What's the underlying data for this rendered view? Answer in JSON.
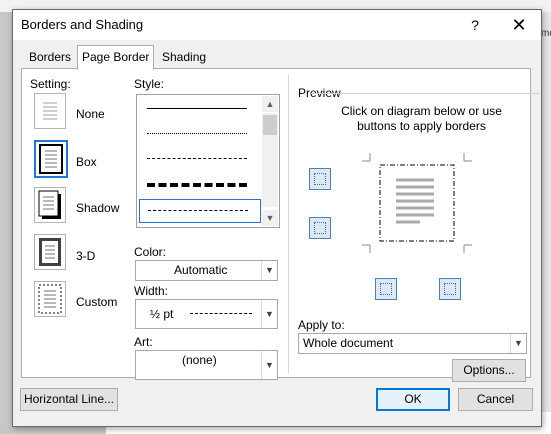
{
  "background": {
    "side_text": "mo"
  },
  "window": {
    "title": "Borders and Shading",
    "help_glyph": "?",
    "close_glyph": "✕"
  },
  "tabs": [
    {
      "label": "Borders",
      "active": false
    },
    {
      "label": "Page Border",
      "active": true
    },
    {
      "label": "Shading",
      "active": false
    }
  ],
  "setting": {
    "heading": "Setting:",
    "items": [
      {
        "label": "None",
        "selected": false
      },
      {
        "label": "Box",
        "selected": true
      },
      {
        "label": "Shadow",
        "selected": false
      },
      {
        "label": "3-D",
        "selected": false
      },
      {
        "label": "Custom",
        "selected": false
      }
    ]
  },
  "style": {
    "heading": "Style:"
  },
  "color": {
    "heading": "Color:",
    "value": "Automatic"
  },
  "width": {
    "heading": "Width:",
    "value": "½ pt"
  },
  "art": {
    "heading": "Art:",
    "value": "(none)"
  },
  "preview": {
    "heading": "Preview",
    "hint": "Click on diagram below or use buttons to apply borders"
  },
  "apply_to": {
    "heading": "Apply to:",
    "value": "Whole document"
  },
  "buttons": {
    "options": "Options...",
    "horizontal_line": "Horizontal Line...",
    "ok": "OK",
    "cancel": "Cancel"
  },
  "colors": {
    "accent": "#0078d7",
    "selection": "#1e78d7"
  },
  "icons": {
    "dropdown_arrow": "chevron-down-icon",
    "close": "close-icon"
  }
}
